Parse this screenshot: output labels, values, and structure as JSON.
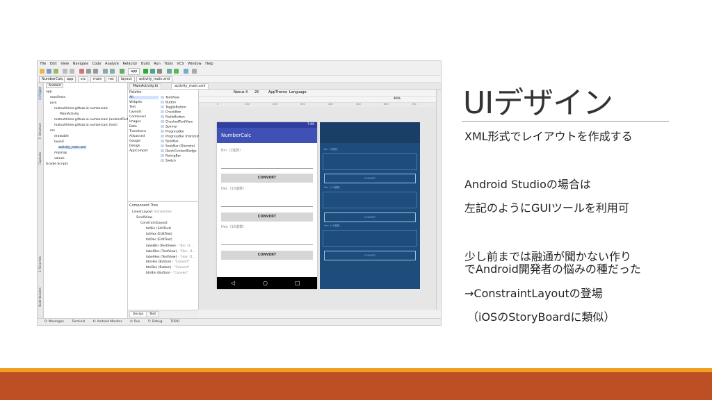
{
  "slide": {
    "title": "UIデザイン",
    "bullets": [
      "XML形式でレイアウトを作成する",
      "Android Studioの場合は",
      "左記のようにGUIツールを利用可",
      "少し前までは融通が聞かない作り",
      "でAndroid開発者の悩みの種だった",
      "→ConstraintLayoutの登場",
      "（iOSのStoryBoardに類似）"
    ],
    "colors": {
      "accent": "#f0a01e",
      "footer": "#bc4f23"
    }
  },
  "ide": {
    "menu": [
      "File",
      "Edit",
      "View",
      "Navigate",
      "Code",
      "Analyze",
      "Refactor",
      "Build",
      "Run",
      "Tools",
      "VCS",
      "Window",
      "Help"
    ],
    "breadcrumbs": [
      "NumberCalc",
      "app",
      "src",
      "main",
      "res",
      "layout",
      "activity_main.xml"
    ],
    "run_config": "app",
    "left_tabs": [
      "1: Project",
      "7: Structure",
      "Captures",
      "2: Favorites",
      "Build Variants"
    ],
    "project_view": "Android",
    "project_tree": [
      "app",
      "manifests",
      "java",
      "matsuhhime.github.io.numbercalc",
      "MainActivity",
      "matsuhhime.github.io.numbercalc (androidTest)",
      "matsuhhime.github.io.numbercalc (test)",
      "res",
      "drawable",
      "layout",
      "activity_main.xml",
      "mipmap",
      "values",
      "Gradle Scripts"
    ],
    "editor_tabs": [
      "MainActivity.kt",
      "activity_main.xml"
    ],
    "palette_title": "Palette",
    "palette_categories": [
      "All",
      "Widgets",
      "Text",
      "Layouts",
      "Containers",
      "Images",
      "Date",
      "Transitions",
      "Advanced",
      "Google",
      "Design",
      "AppCompat"
    ],
    "palette_items": [
      "TextView",
      "Button",
      "ToggleButton",
      "CheckBox",
      "RadioButton",
      "CheckedTextView",
      "Spinner",
      "ProgressBar",
      "ProgressBar (Horizontal)",
      "SeekBar",
      "SeekBar (Discrete)",
      "QuickContactBadge",
      "RatingBar",
      "Switch"
    ],
    "component_tree_title": "Component Tree",
    "component_tree": [
      {
        "name": "LinearLayout",
        "extra": "(horizontal)"
      },
      {
        "name": "ScrollView",
        "extra": ""
      },
      {
        "name": "ConstraintLayout",
        "extra": ""
      },
      {
        "name": "txtBin (EditText)",
        "extra": ""
      },
      {
        "name": "txtHex (EditText)",
        "extra": ""
      },
      {
        "name": "txtDec (EditText)",
        "extra": ""
      },
      {
        "name": "labelBin (TextView)",
        "extra": "- \"Bin（2..."
      },
      {
        "name": "labelDec (TextView)",
        "extra": "- \"Dec（1..."
      },
      {
        "name": "labelHex (TextView)",
        "extra": "- \"Hex（1..."
      },
      {
        "name": "btnHex (Button)",
        "extra": "- \"Convert\""
      },
      {
        "name": "btnDec (Button)",
        "extra": "- \"Convert\""
      },
      {
        "name": "btnBin (Button)",
        "extra": "- \"Convert\""
      }
    ],
    "design_tabs": [
      "Design",
      "Text"
    ],
    "design_toolbar": {
      "device": "Nexus 4",
      "api": "25",
      "theme": "AppTheme",
      "language": "Language",
      "zoom": "49%"
    },
    "ruler": [
      "0",
      "100",
      "200",
      "300",
      "400",
      "500",
      "600",
      "700"
    ],
    "phone": {
      "time": "7:00",
      "app_title": "NumberCalc",
      "labels": [
        "Bin（2進数）",
        "Dec（10進数）",
        "Hex（16進数）"
      ],
      "button": "CONVERT",
      "nav": [
        "◁",
        "○",
        "□"
      ]
    },
    "blueprint": {
      "labels": [
        "Bin（2進数）",
        "Dec（10進数）",
        "Hex（16進数）"
      ],
      "button": "CONVERT"
    },
    "status_tabs": [
      "0: Messages",
      "Terminal",
      "6: Android Monitor",
      "4: Run",
      "5: Debug",
      "TODO"
    ]
  }
}
